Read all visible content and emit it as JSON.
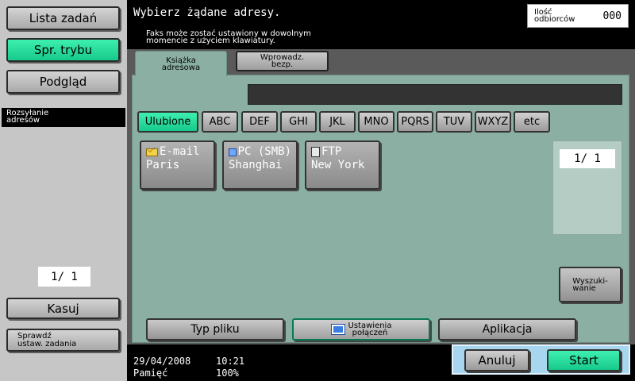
{
  "left_panel": {
    "job_list": "Lista zadań",
    "mode_check": "Spr. trybu",
    "preview": "Podgląd",
    "mode_label": "Rozsyłanie\nadresów",
    "page": "1/  1",
    "delete": "Kasuj",
    "check_job": "Sprawdź\nustaw. zadania"
  },
  "header": {
    "title": "Wybierz żądane adresy.",
    "subtitle": "Faks może zostać ustawiony w dowolnym\nmomencie z użyciem klawiatury.",
    "recipients_label": "Ilość\nodbiorców",
    "recipients_count": "000"
  },
  "tabs": {
    "address_book": "Książka\nadresowa",
    "manual_input": "Wprowadz.\nbezp."
  },
  "index_tabs": [
    "Ulubione",
    "ABC",
    "DEF",
    "GHI",
    "JKL",
    "MNO",
    "PQRS",
    "TUV",
    "WXYZ",
    "etc"
  ],
  "destinations": [
    {
      "type": "E-mail",
      "name": "Paris",
      "icon": "mail-icon"
    },
    {
      "type": "PC (SMB)",
      "name": "Shanghai",
      "icon": "pc-icon"
    },
    {
      "type": "FTP",
      "name": "New York",
      "icon": "ftp-icon"
    }
  ],
  "page_indicator": "1/  1",
  "search_button": "Wyszuki-\nwanie",
  "bottom_buttons": {
    "file_type": "Typ pliku",
    "connection_settings": "Ustawienia\npołączeń",
    "application": "Aplikacja"
  },
  "footer": {
    "date": "29/04/2008",
    "time": "10:21",
    "memory_label": "Pamięć",
    "memory_value": "100%"
  },
  "actions": {
    "cancel": "Anuluj",
    "start": "Start"
  },
  "colors": {
    "accent_green": "#17c98a",
    "panel_teal": "#8bb0a3",
    "action_bar_blue": "#a9d6ef"
  }
}
